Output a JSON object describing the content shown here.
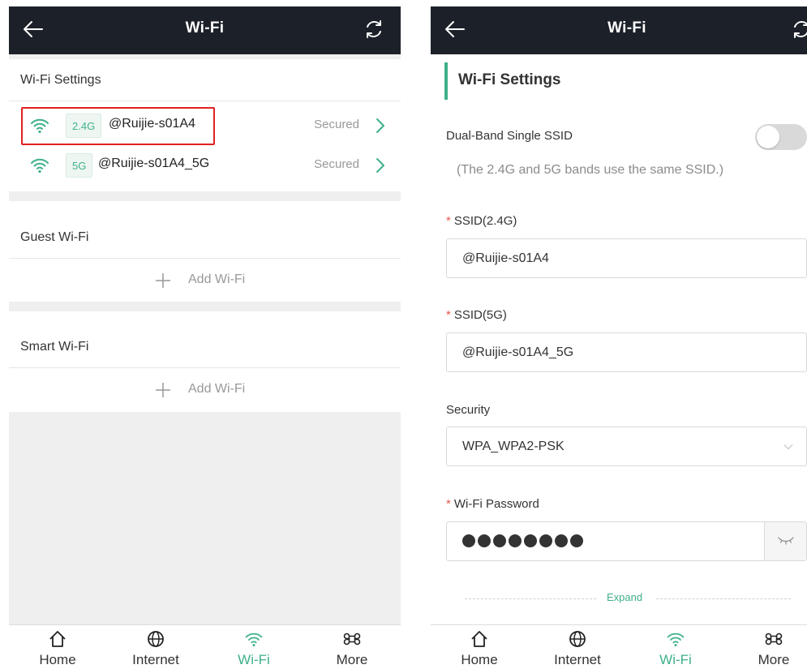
{
  "colors": {
    "accent": "#3eb08b",
    "topbar": "#1c2129",
    "required": "#e55a4e",
    "highlight": "#e02020"
  },
  "left": {
    "topbar": {
      "title": "Wi-Fi",
      "back_icon": "arrow-left-icon",
      "refresh_icon": "refresh-icon"
    },
    "wifi_settings": {
      "title": "Wi-Fi Settings",
      "items": [
        {
          "band": "2.4G",
          "ssid": "@Ruijie-s01A4",
          "status": "Secured"
        },
        {
          "band": "5G",
          "ssid": "@Ruijie-s01A4_5G",
          "status": "Secured"
        }
      ]
    },
    "guest_wifi": {
      "title": "Guest Wi-Fi",
      "add_label": "Add Wi-Fi"
    },
    "smart_wifi": {
      "title": "Smart Wi-Fi",
      "add_label": "Add Wi-Fi"
    }
  },
  "right": {
    "topbar": {
      "title": "Wi-Fi",
      "back_icon": "arrow-left-icon",
      "refresh_icon": "refresh-icon"
    },
    "section_title": "Wi-Fi Settings",
    "dual_band": {
      "label": "Dual-Band Single SSID",
      "hint": "(The 2.4G and 5G bands use the same SSID.)",
      "enabled": false
    },
    "ssid24": {
      "required_mark": "*",
      "label": "SSID(2.4G)",
      "value": "@Ruijie-s01A4"
    },
    "ssid5": {
      "required_mark": "*",
      "label": "SSID(5G)",
      "value": "@Ruijie-s01A4_5G"
    },
    "security": {
      "label": "Security",
      "value": "WPA_WPA2-PSK"
    },
    "password": {
      "required_mark": "*",
      "label": "Wi-Fi Password",
      "masked_length": 8
    },
    "expand_label": "Expand"
  },
  "nav": [
    {
      "label": "Home",
      "icon": "home-icon",
      "active": false
    },
    {
      "label": "Internet",
      "icon": "globe-icon",
      "active": false
    },
    {
      "label": "Wi-Fi",
      "icon": "wifi-icon",
      "active": true
    },
    {
      "label": "More",
      "icon": "command-icon",
      "active": false
    }
  ]
}
